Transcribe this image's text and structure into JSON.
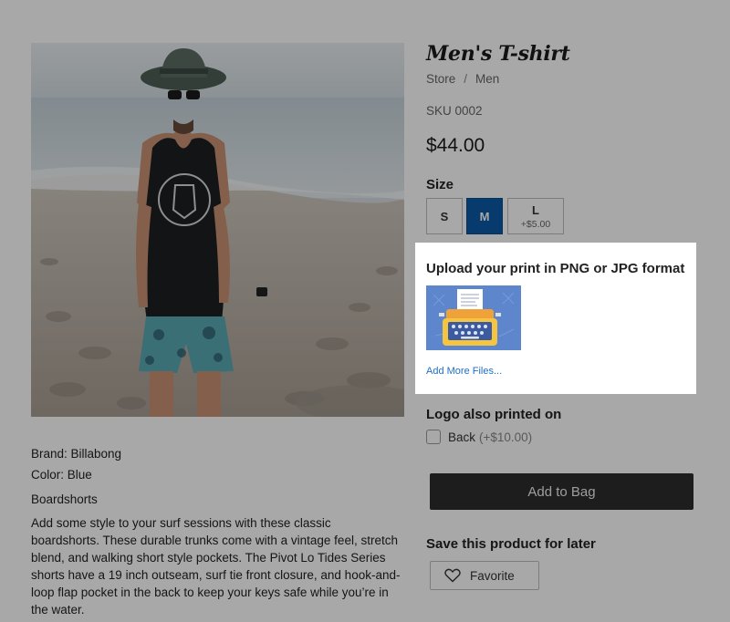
{
  "product": {
    "title": "Men's T-shirt",
    "breadcrumb": [
      "Store",
      "Men"
    ],
    "breadcrumb_separator": "/",
    "sku": "SKU 0002",
    "price": "$44.00"
  },
  "size": {
    "label": "Size",
    "options": [
      {
        "label": "S",
        "extra": ""
      },
      {
        "label": "M",
        "extra": ""
      },
      {
        "label": "L",
        "extra": "+$5.00"
      }
    ],
    "selected": "M",
    "selected_color": "#0b5aa6"
  },
  "upload": {
    "title": "Upload your print in PNG or JPG format",
    "add_more": "Add More Files..."
  },
  "logo": {
    "label": "Logo also printed on",
    "option_label": "Back",
    "option_price": "(+$10.00)",
    "checked": false
  },
  "actions": {
    "add_to_bag": "Add to Bag",
    "save_label": "Save this product for later",
    "favorite": "Favorite"
  },
  "info": {
    "brand": "Brand: Billabong",
    "color": "Color: Blue",
    "kind": "Boardshorts",
    "description": "Add some style to your surf sessions with these classic boardshorts. These durable trunks come with a vintage feel, stretch blend, and walking short style pockets. The Pivot Lo Tides Series shorts have a 19 inch outseam, surf tie front closure, and hook-and-loop flap pocket in the back to keep your keys safe while you’re in the water."
  },
  "colors": {
    "overlay": "rgba(0,0,0,0.34)",
    "button_dark": "#2d2d2d",
    "link": "#1f6fc4"
  }
}
